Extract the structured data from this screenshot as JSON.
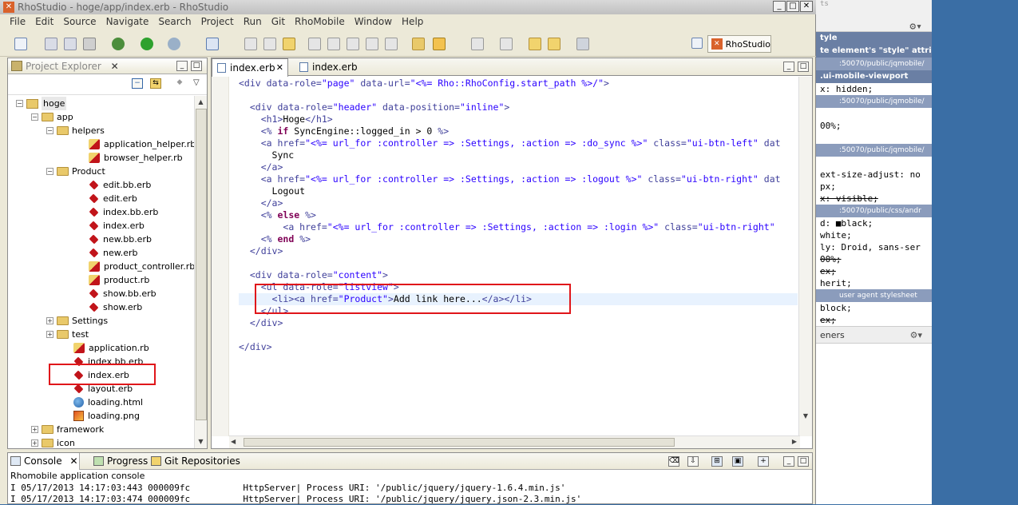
{
  "window": {
    "title": "RhoStudio - hoge/app/index.erb - RhoStudio"
  },
  "menu": [
    "File",
    "Edit",
    "Source",
    "Navigate",
    "Search",
    "Project",
    "Run",
    "Git",
    "RhoMobile",
    "Window",
    "Help"
  ],
  "perspective": {
    "label": "RhoStudio"
  },
  "explorer": {
    "title": "Project Explorer",
    "items": [
      {
        "label": "hoge",
        "depth": 0,
        "kind": "project",
        "expand": "−"
      },
      {
        "label": "app",
        "depth": 1,
        "kind": "folder",
        "expand": "−"
      },
      {
        "label": "helpers",
        "depth": 2,
        "kind": "folder",
        "expand": "−"
      },
      {
        "label": "application_helper.rb",
        "depth": 3,
        "kind": "rubyfile"
      },
      {
        "label": "browser_helper.rb",
        "depth": 3,
        "kind": "rubyfile"
      },
      {
        "label": "Product",
        "depth": 2,
        "kind": "folder",
        "expand": "−"
      },
      {
        "label": "edit.bb.erb",
        "depth": 3,
        "kind": "erb"
      },
      {
        "label": "edit.erb",
        "depth": 3,
        "kind": "erb"
      },
      {
        "label": "index.bb.erb",
        "depth": 3,
        "kind": "erb"
      },
      {
        "label": "index.erb",
        "depth": 3,
        "kind": "erb"
      },
      {
        "label": "new.bb.erb",
        "depth": 3,
        "kind": "erb"
      },
      {
        "label": "new.erb",
        "depth": 3,
        "kind": "erb"
      },
      {
        "label": "product_controller.rb",
        "depth": 3,
        "kind": "rubyfile"
      },
      {
        "label": "product.rb",
        "depth": 3,
        "kind": "rubyfile"
      },
      {
        "label": "show.bb.erb",
        "depth": 3,
        "kind": "erb"
      },
      {
        "label": "show.erb",
        "depth": 3,
        "kind": "erb"
      },
      {
        "label": "Settings",
        "depth": 2,
        "kind": "folder",
        "expand": "+"
      },
      {
        "label": "test",
        "depth": 2,
        "kind": "folder",
        "expand": "+"
      },
      {
        "label": "application.rb",
        "depth": 2,
        "kind": "rubyfile"
      },
      {
        "label": "index.bb.erb",
        "depth": 2,
        "kind": "erb"
      },
      {
        "label": "index.erb",
        "depth": 2,
        "kind": "erb"
      },
      {
        "label": "layout.erb",
        "depth": 2,
        "kind": "erb"
      },
      {
        "label": "loading.html",
        "depth": 2,
        "kind": "html"
      },
      {
        "label": "loading.png",
        "depth": 2,
        "kind": "png"
      },
      {
        "label": "framework",
        "depth": 1,
        "kind": "folder",
        "expand": "+"
      },
      {
        "label": "icon",
        "depth": 1,
        "kind": "folder",
        "expand": "+"
      }
    ]
  },
  "editor": {
    "tabs": [
      {
        "label": "index.erb",
        "active": true
      },
      {
        "label": "index.erb",
        "active": false
      }
    ],
    "lines": [
      [
        [
          "tg",
          "<div "
        ],
        [
          "at",
          "data-role="
        ],
        [
          "st",
          "\"page\""
        ],
        [
          "at",
          " data-url="
        ],
        [
          "st",
          "\"<%= Rho::RhoConfig.start_path %>/\""
        ],
        [
          "tg",
          ">"
        ]
      ],
      [],
      [
        [
          "rb",
          "  "
        ],
        [
          "tg",
          "<div "
        ],
        [
          "at",
          "data-role="
        ],
        [
          "st",
          "\"header\""
        ],
        [
          "at",
          " data-position="
        ],
        [
          "st",
          "\"inline\""
        ],
        [
          "tg",
          ">"
        ]
      ],
      [
        [
          "rb",
          "    "
        ],
        [
          "tg",
          "<h1>"
        ],
        [
          "rb",
          "Hoge"
        ],
        [
          "tg",
          "</h1>"
        ]
      ],
      [
        [
          "rb",
          "    "
        ],
        [
          "tg",
          "<% "
        ],
        [
          "kw",
          "if"
        ],
        [
          "rb",
          " SyncEngine::logged_in > 0 "
        ],
        [
          "tg",
          "%>"
        ]
      ],
      [
        [
          "rb",
          "    "
        ],
        [
          "tg",
          "<a "
        ],
        [
          "at",
          "href="
        ],
        [
          "st",
          "\"<%= url_for :controller => :Settings, :action => :do_sync %>\""
        ],
        [
          "at",
          " class="
        ],
        [
          "st",
          "\"ui-btn-left\""
        ],
        [
          "at",
          " dat"
        ]
      ],
      [
        [
          "rb",
          "      Sync"
        ]
      ],
      [
        [
          "rb",
          "    "
        ],
        [
          "tg",
          "</a>"
        ]
      ],
      [
        [
          "rb",
          "    "
        ],
        [
          "tg",
          "<a "
        ],
        [
          "at",
          "href="
        ],
        [
          "st",
          "\"<%= url_for :controller => :Settings, :action => :logout %>\""
        ],
        [
          "at",
          " class="
        ],
        [
          "st",
          "\"ui-btn-right\""
        ],
        [
          "at",
          " dat"
        ]
      ],
      [
        [
          "rb",
          "      Logout"
        ]
      ],
      [
        [
          "rb",
          "    "
        ],
        [
          "tg",
          "</a>"
        ]
      ],
      [
        [
          "rb",
          "    "
        ],
        [
          "tg",
          "<% "
        ],
        [
          "kw",
          "else"
        ],
        [
          "tg",
          " %>"
        ]
      ],
      [
        [
          "rb",
          "        "
        ],
        [
          "tg",
          "<a "
        ],
        [
          "at",
          "href="
        ],
        [
          "st",
          "\"<%= url_for :controller => :Settings, :action => :login %>\""
        ],
        [
          "at",
          " class="
        ],
        [
          "st",
          "\"ui-btn-right\""
        ]
      ],
      [
        [
          "rb",
          "    "
        ],
        [
          "tg",
          "<% "
        ],
        [
          "kw",
          "end"
        ],
        [
          "tg",
          " %>"
        ]
      ],
      [
        [
          "rb",
          "  "
        ],
        [
          "tg",
          "</div>"
        ]
      ],
      [],
      [
        [
          "rb",
          "  "
        ],
        [
          "tg",
          "<div "
        ],
        [
          "at",
          "data-role="
        ],
        [
          "st",
          "\"content\""
        ],
        [
          "tg",
          ">"
        ]
      ],
      [
        [
          "rb",
          "    "
        ],
        [
          "tg",
          "<ul "
        ],
        [
          "at",
          "data-role="
        ],
        [
          "st",
          "\"listview\""
        ],
        [
          "tg",
          ">"
        ]
      ],
      [
        [
          "rb",
          "      "
        ],
        [
          "tg",
          "<li><a "
        ],
        [
          "at",
          "href="
        ],
        [
          "st",
          "\"Product\""
        ],
        [
          "tg",
          ">"
        ],
        [
          "rb",
          "Add link here..."
        ],
        [
          "tg",
          "</a></li>"
        ]
      ],
      [
        [
          "rb",
          "    "
        ],
        [
          "tg",
          "</ul>"
        ]
      ],
      [
        [
          "rb",
          "  "
        ],
        [
          "tg",
          "</div>"
        ]
      ],
      [],
      [
        [
          "tg",
          "</div>"
        ]
      ]
    ]
  },
  "console": {
    "tabs": [
      "Console",
      "Progress",
      "Git Repositories"
    ],
    "name": "Rhomobile application console",
    "lines": [
      "I 05/17/2013 14:17:03:443 000009fc          HttpServer| Process URI: '/public/jquery/jquery-1.6.4.min.js'",
      "I 05/17/2013 14:17:03:474 000009fc          HttpServer| Process URI: '/public/jquery/jquery.json-2.3.min.js'"
    ]
  },
  "devtools": {
    "rows": [
      {
        "t": "hdr",
        "text": "tyle"
      },
      {
        "t": "hdr",
        "text": "te    element's \"style\" attri"
      },
      {
        "t": "sub",
        "text": ":50070/public/jqmobile/"
      },
      {
        "t": "hdr",
        "text": ".ui-mobile-viewport"
      },
      {
        "t": "row",
        "text": "x: hidden;"
      },
      {
        "t": "sub",
        "text": ":50070/public/jqmobile/"
      },
      {
        "t": "row",
        "text": ""
      },
      {
        "t": "row",
        "text": "00%;"
      },
      {
        "t": "row",
        "text": ""
      },
      {
        "t": "sub",
        "text": ":50070/public/jqmobile/"
      },
      {
        "t": "row",
        "text": ""
      },
      {
        "t": "row",
        "text": "ext-size-adjust: no"
      },
      {
        "t": "row",
        "text": "px;"
      },
      {
        "t": "row",
        "text": "x: visible;",
        "strike": true
      },
      {
        "t": "sub",
        "text": ":50070/public/css/andr"
      },
      {
        "t": "row",
        "text": "d: ■black;"
      },
      {
        "t": "row",
        "text": "white;"
      },
      {
        "t": "row",
        "text": "ly: Droid, sans-ser"
      },
      {
        "t": "row",
        "text": "00%;",
        "strike": true
      },
      {
        "t": "row",
        "text": "ex;",
        "strike": true
      },
      {
        "t": "row",
        "text": "herit;"
      },
      {
        "t": "sub",
        "text": "user agent stylesheet"
      },
      {
        "t": "row",
        "text": "block;"
      },
      {
        "t": "row",
        "text": "ex;",
        "strike": true
      }
    ],
    "listeners_label": "eners",
    "scrollbar_hint": "ts"
  }
}
